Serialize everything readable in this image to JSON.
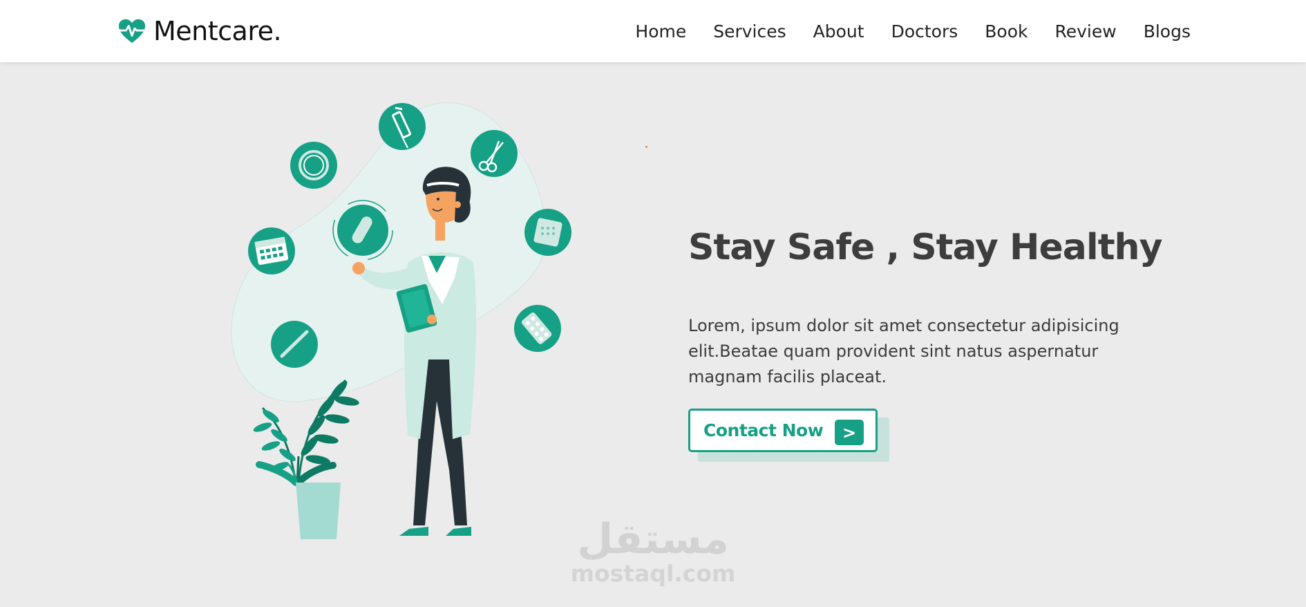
{
  "brand": {
    "name": "Mentcare.",
    "icon": "heart-pulse-icon",
    "color": "#16a085"
  },
  "nav": {
    "items": [
      {
        "label": "Home"
      },
      {
        "label": "Services"
      },
      {
        "label": "About"
      },
      {
        "label": "Doctors"
      },
      {
        "label": "Book"
      },
      {
        "label": "Review"
      },
      {
        "label": "Blogs"
      }
    ]
  },
  "hero": {
    "title": "Stay Safe , Stay Healthy",
    "paragraph": "Lorem, ipsum dolor sit amet consectetur adipisicing elit.Beatae quam provident sint natus aspernatur magnam facilis placeat.",
    "cta": {
      "label": "Contact Now",
      "arrow": ">"
    }
  },
  "illustration": {
    "icons": [
      "syringe-icon",
      "ring-icon",
      "scissors-icon",
      "capsule-icon",
      "bandage-icon",
      "calendar-icon",
      "thermometer-icon",
      "pills-icon"
    ]
  },
  "watermark": {
    "arabic": "مستقل",
    "latin": "mostaql.com"
  },
  "colors": {
    "accent": "#16a085",
    "background": "#ebebeb",
    "header_bg": "#ffffff",
    "title": "#3d3d3d",
    "blob": "#e6f2ef"
  }
}
